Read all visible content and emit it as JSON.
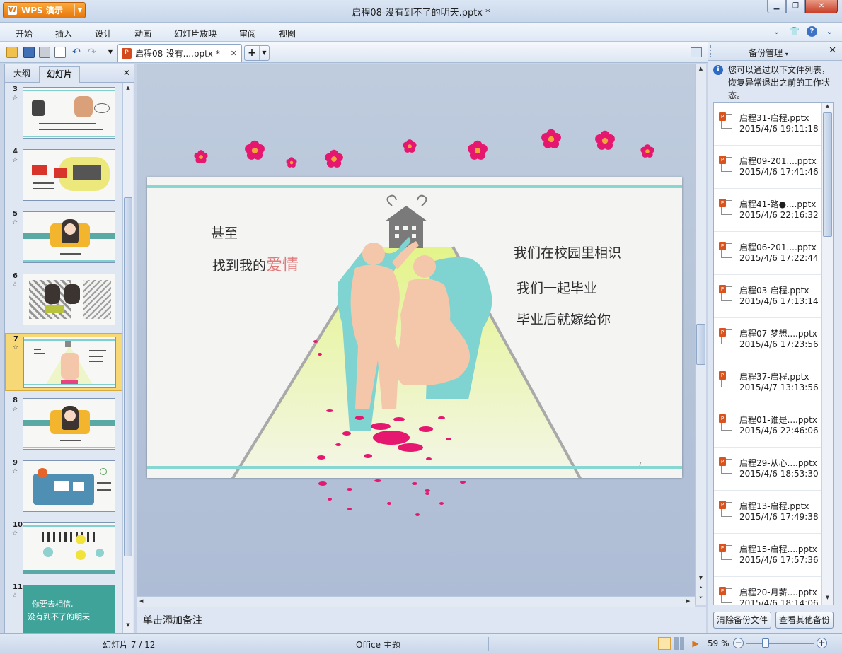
{
  "app": {
    "name": "WPS 演示",
    "logo": "W"
  },
  "window": {
    "title": "启程08-没有到不了的明天.pptx *"
  },
  "menu": [
    "开始",
    "插入",
    "设计",
    "动画",
    "幻灯片放映",
    "审阅",
    "视图"
  ],
  "tab": {
    "label": "启程08-没有....pptx *"
  },
  "left_panel": {
    "tabs": [
      "大纲",
      "幻灯片"
    ],
    "active_tab": "幻灯片",
    "slides": [
      {
        "num": "3"
      },
      {
        "num": "4"
      },
      {
        "num": "5"
      },
      {
        "num": "6"
      },
      {
        "num": "7"
      },
      {
        "num": "8"
      },
      {
        "num": "9"
      },
      {
        "num": "10"
      },
      {
        "num": "11"
      }
    ],
    "selected_slide": "7",
    "slide11_text": [
      "你要去相信,",
      "没有到不了的明天"
    ]
  },
  "slide": {
    "left_line1": "甚至",
    "left_line2_prefix": "找到我的",
    "left_line2_emph": "爱情",
    "right_lines": [
      "我们在校园里相识",
      "我们一起毕业",
      "毕业后就嫁给你"
    ],
    "page_number": "7"
  },
  "notes": {
    "placeholder": "单击添加备注"
  },
  "backup_panel": {
    "title": "备份管理",
    "info": "您可以通过以下文件列表，恢复异常退出之前的工作状态。",
    "files": [
      {
        "name": "启程31-启程.pptx",
        "date": "2015/4/6 19:11:18"
      },
      {
        "name": "启程09-201....pptx",
        "date": "2015/4/6 17:41:46"
      },
      {
        "name": "启程41-路●....pptx",
        "date": "2015/4/6 22:16:32"
      },
      {
        "name": "启程06-201....pptx",
        "date": "2015/4/6 17:22:44"
      },
      {
        "name": "启程03-启程.pptx",
        "date": "2015/4/6 17:13:14"
      },
      {
        "name": "启程07-梦想....pptx",
        "date": "2015/4/6 17:23:56"
      },
      {
        "name": "启程37-启程.pptx",
        "date": "2015/4/7 13:13:56"
      },
      {
        "name": "启程01-谁是....pptx",
        "date": "2015/4/6 22:46:06"
      },
      {
        "name": "启程29-从心....pptx",
        "date": "2015/4/6 18:53:30"
      },
      {
        "name": "启程13-启程.pptx",
        "date": "2015/4/6 17:49:38"
      },
      {
        "name": "启程15-启程....pptx",
        "date": "2015/4/6 17:57:36"
      },
      {
        "name": "启程20-月薪....pptx",
        "date": "2015/4/6 18:14:06"
      }
    ],
    "btn_clear": "清除备份文件",
    "btn_view": "查看其他备份"
  },
  "status": {
    "slide_info": "幻灯片 7 / 12",
    "theme": "Office 主题",
    "zoom": "59 %"
  },
  "colors": {
    "accent": "#e7760c",
    "slide_band": "#86d6d2",
    "flower": "#e5176f",
    "silhouette": "#f5c7aa",
    "silhouette_shadow": "#7fd3d0"
  },
  "icons": {
    "toolbar": [
      "open-folder-icon",
      "save-icon",
      "print-icon",
      "print-preview-icon",
      "undo-icon",
      "redo-icon"
    ],
    "menu_right": [
      "chevron-down-icon",
      "skin-icon",
      "help-icon"
    ]
  }
}
